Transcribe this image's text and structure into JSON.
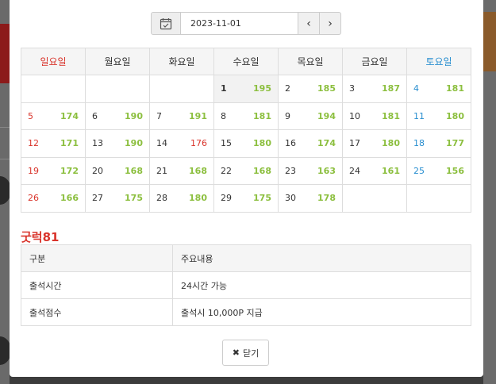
{
  "datepicker": {
    "date_value": "2023-11-01",
    "icon": "calendar-icon",
    "prev_icon": "chevron-left-icon",
    "next_icon": "chevron-right-icon",
    "prev_label": "‹",
    "next_label": "›"
  },
  "calendar": {
    "weekdays": [
      "일요일",
      "월요일",
      "화요일",
      "수요일",
      "목요일",
      "금요일",
      "토요일"
    ],
    "weeks": [
      [
        null,
        null,
        null,
        {
          "day": "1",
          "count": "195",
          "today": true
        },
        {
          "day": "2",
          "count": "185"
        },
        {
          "day": "3",
          "count": "187"
        },
        {
          "day": "4",
          "count": "181"
        }
      ],
      [
        {
          "day": "5",
          "count": "174"
        },
        {
          "day": "6",
          "count": "190"
        },
        {
          "day": "7",
          "count": "191"
        },
        {
          "day": "8",
          "count": "181"
        },
        {
          "day": "9",
          "count": "194"
        },
        {
          "day": "10",
          "count": "181"
        },
        {
          "day": "11",
          "count": "180"
        }
      ],
      [
        {
          "day": "12",
          "count": "171"
        },
        {
          "day": "13",
          "count": "190"
        },
        {
          "day": "14",
          "count": "176",
          "holiday": true
        },
        {
          "day": "15",
          "count": "180"
        },
        {
          "day": "16",
          "count": "174"
        },
        {
          "day": "17",
          "count": "180"
        },
        {
          "day": "18",
          "count": "177"
        }
      ],
      [
        {
          "day": "19",
          "count": "172"
        },
        {
          "day": "20",
          "count": "168"
        },
        {
          "day": "21",
          "count": "168"
        },
        {
          "day": "22",
          "count": "168"
        },
        {
          "day": "23",
          "count": "163"
        },
        {
          "day": "24",
          "count": "161"
        },
        {
          "day": "25",
          "count": "156"
        }
      ],
      [
        {
          "day": "26",
          "count": "166"
        },
        {
          "day": "27",
          "count": "175"
        },
        {
          "day": "28",
          "count": "180"
        },
        {
          "day": "29",
          "count": "175"
        },
        {
          "day": "30",
          "count": "178"
        },
        null,
        null
      ]
    ]
  },
  "info": {
    "title": "굿럭81",
    "headers": [
      "구분",
      "주요내용"
    ],
    "rows": [
      [
        "출석시간",
        "24시간 가능"
      ],
      [
        "출석점수",
        "출석시 10,000P 지급"
      ]
    ]
  },
  "close_button": {
    "label": "닫기",
    "icon": "close-icon"
  },
  "colors": {
    "sunday": "#d9342b",
    "saturday": "#2a8fd0",
    "count": "#8cbf3f",
    "title": "#d9342b"
  }
}
